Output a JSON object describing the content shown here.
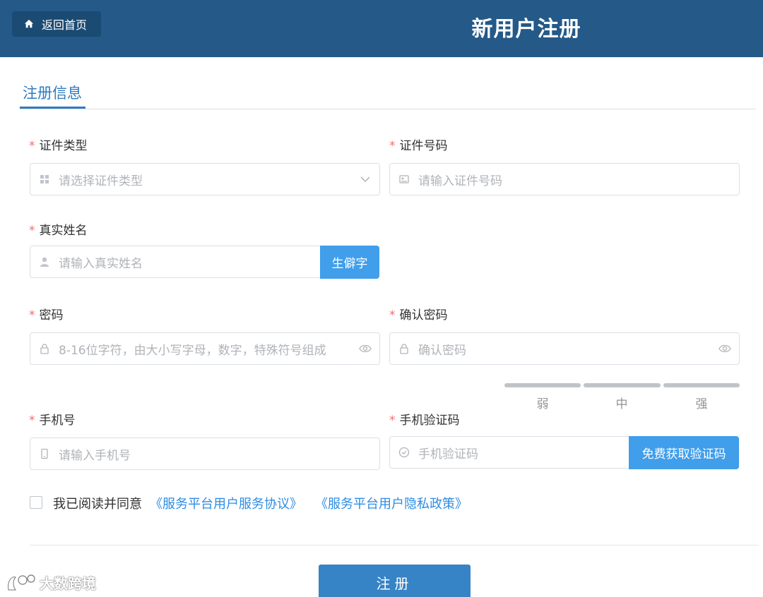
{
  "header": {
    "home_label": "返回首页",
    "title": "新用户注册"
  },
  "tab": {
    "label": "注册信息"
  },
  "form": {
    "required_mark": "*",
    "id_type": {
      "label": "证件类型",
      "placeholder": "请选择证件类型"
    },
    "id_number": {
      "label": "证件号码",
      "placeholder": "请输入证件号码"
    },
    "real_name": {
      "label": "真实姓名",
      "placeholder": "请输入真实姓名",
      "button": "生僻字"
    },
    "password": {
      "label": "密码",
      "placeholder": "8-16位字符，由大小写字母，数字，特殊符号组成"
    },
    "confirm_password": {
      "label": "确认密码",
      "placeholder": "确认密码"
    },
    "strength": {
      "weak": "弱",
      "medium": "中",
      "strong": "强"
    },
    "phone": {
      "label": "手机号",
      "placeholder": "请输入手机号"
    },
    "sms_code": {
      "label": "手机验证码",
      "placeholder": "手机验证码",
      "button": "免费获取验证码"
    }
  },
  "agreement": {
    "text": "我已阅读并同意",
    "service_link": "《服务平台用户服务协议》",
    "privacy_link": "《服务平台用户隐私政策》"
  },
  "submit_label": "注册",
  "watermark": "大数跨境",
  "colors": {
    "header_bg": "#245988",
    "accent": "#2f7bbf",
    "button_blue": "#409eea",
    "link": "#2d8ce3",
    "required": "#f56c6c"
  }
}
